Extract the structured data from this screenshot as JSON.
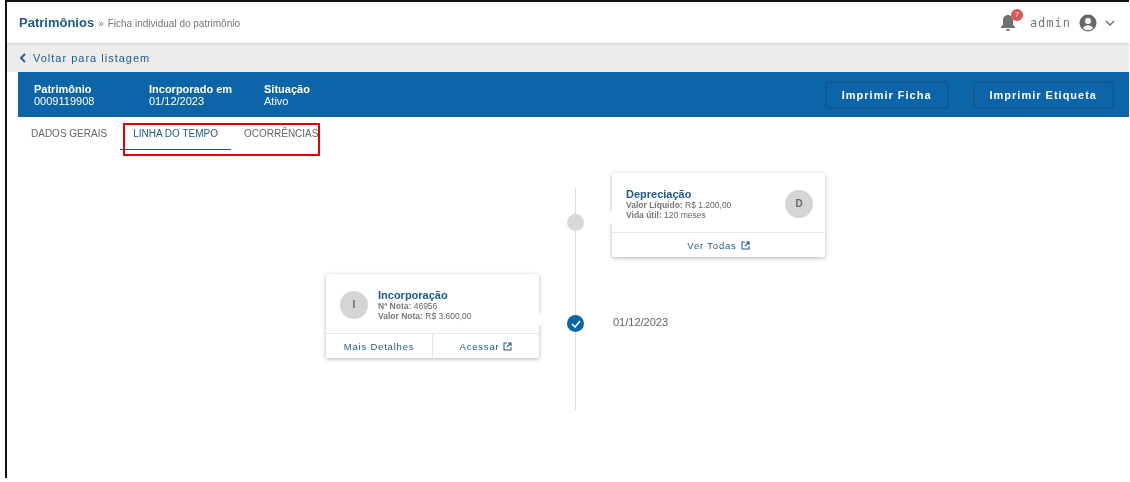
{
  "breadcrumb": {
    "root": "Patrimônios",
    "separator": "»",
    "current": "Ficha individual do patrimônio"
  },
  "notifications": {
    "count": "7"
  },
  "user": {
    "name": "admin"
  },
  "back_link": "Voltar para listagem",
  "header": {
    "fields": [
      {
        "label": "Patrimônio",
        "value": "0009119908"
      },
      {
        "label": "Incorporado em",
        "value": "01/12/2023"
      },
      {
        "label": "Situação",
        "value": "Ativo"
      }
    ],
    "buttons": [
      "Imprimir Ficha",
      "Imprimir Etiqueta"
    ]
  },
  "tabs": [
    {
      "label": "DADOS GERAIS",
      "selected": false
    },
    {
      "label": "LINHA DO TEMPO",
      "selected": true
    },
    {
      "label": "OCORRÊNCIAS",
      "selected": false
    }
  ],
  "timeline": {
    "events": [
      {
        "kind": "right",
        "done": false,
        "initial": "D",
        "title": "Depreciação",
        "lines": [
          {
            "label": "Valor Líquido:",
            "value": "R$ 1.200,00"
          },
          {
            "label": "Vida útil:",
            "value": "120 meses"
          }
        ],
        "actions": [
          {
            "label": "Ver Todas",
            "external": true
          }
        ]
      },
      {
        "kind": "left",
        "done": true,
        "initial": "I",
        "title": "Incorporação",
        "date": "01/12/2023",
        "lines": [
          {
            "label": "Nº Nota:",
            "value": "46956"
          },
          {
            "label": "Valor Nota:",
            "value": "R$ 3.600,00"
          }
        ],
        "actions": [
          {
            "label": "Mais Detalhes",
            "external": false
          },
          {
            "label": "Acessar",
            "external": true
          }
        ]
      }
    ]
  }
}
